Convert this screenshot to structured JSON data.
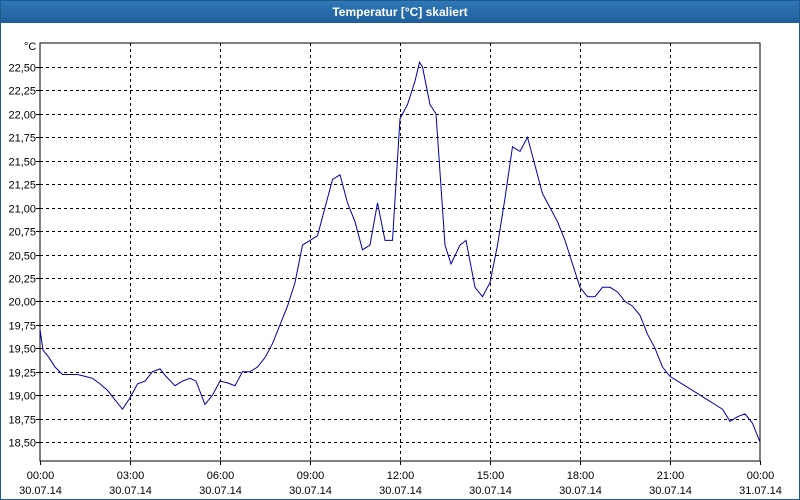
{
  "window": {
    "title": "Temperatur [°C] skaliert"
  },
  "colors": {
    "line": "#0000aa",
    "grid": "#000000",
    "titlebar": "#1f5f99"
  },
  "chart_data": {
    "type": "line",
    "title": "Temperatur [°C] skaliert",
    "yunit": "°C",
    "ylim": [
      18.4,
      22.75
    ],
    "xlim": [
      0,
      24
    ],
    "grid": true,
    "y_ticks": [
      {
        "value": 18.5,
        "label": "18,50"
      },
      {
        "value": 18.75,
        "label": "18,75"
      },
      {
        "value": 19.0,
        "label": "19,00"
      },
      {
        "value": 19.25,
        "label": "19,25"
      },
      {
        "value": 19.5,
        "label": "19,50"
      },
      {
        "value": 19.75,
        "label": "19,75"
      },
      {
        "value": 20.0,
        "label": "20,00"
      },
      {
        "value": 20.25,
        "label": "20,25"
      },
      {
        "value": 20.5,
        "label": "20,50"
      },
      {
        "value": 20.75,
        "label": "20,75"
      },
      {
        "value": 21.0,
        "label": "21,00"
      },
      {
        "value": 21.25,
        "label": "21,25"
      },
      {
        "value": 21.5,
        "label": "21,50"
      },
      {
        "value": 21.75,
        "label": "21,75"
      },
      {
        "value": 22.0,
        "label": "22,00"
      },
      {
        "value": 22.25,
        "label": "22,25"
      },
      {
        "value": 22.5,
        "label": "22,50"
      }
    ],
    "x_ticks": [
      {
        "value": 0,
        "time": "00:00",
        "date": "30.07.14"
      },
      {
        "value": 3,
        "time": "03:00",
        "date": "30.07.14"
      },
      {
        "value": 6,
        "time": "06:00",
        "date": "30.07.14"
      },
      {
        "value": 9,
        "time": "09:00",
        "date": "30.07.14"
      },
      {
        "value": 12,
        "time": "12:00",
        "date": "30.07.14"
      },
      {
        "value": 15,
        "time": "15:00",
        "date": "30.07.14"
      },
      {
        "value": 18,
        "time": "18:00",
        "date": "30.07.14"
      },
      {
        "value": 21,
        "time": "21:00",
        "date": "30.07.14"
      },
      {
        "value": 24,
        "time": "00:00",
        "date": "31.07.14"
      }
    ],
    "series": [
      {
        "x": [
          0,
          0.1,
          0.3,
          0.5,
          0.75,
          1.0,
          1.25,
          1.5,
          1.75,
          2.0,
          2.25,
          2.5,
          2.75,
          3.0,
          3.25,
          3.5,
          3.75,
          4.0,
          4.2,
          4.5,
          4.75,
          5.0,
          5.2,
          5.5,
          5.75,
          6.0,
          6.25,
          6.5,
          6.75,
          7.0,
          7.25,
          7.5,
          7.75,
          8.0,
          8.25,
          8.5,
          8.75,
          9.0,
          9.25,
          9.5,
          9.75,
          10.0,
          10.25,
          10.5,
          10.75,
          11.0,
          11.25,
          11.5,
          11.75,
          12.0,
          12.25,
          12.5,
          12.65,
          12.75,
          13.0,
          13.2,
          13.5,
          13.7,
          14.0,
          14.2,
          14.5,
          14.75,
          15.0,
          15.25,
          15.5,
          15.75,
          16.0,
          16.25,
          16.5,
          16.75,
          17.0,
          17.25,
          17.5,
          17.75,
          18.0,
          18.25,
          18.5,
          18.75,
          19.0,
          19.25,
          19.5,
          19.75,
          20.0,
          20.25,
          20.5,
          20.75,
          21.0,
          21.25,
          21.5,
          21.75,
          22.0,
          22.25,
          22.5,
          22.75,
          23.0,
          23.25,
          23.5,
          23.75,
          24.0
        ],
        "values": [
          19.7,
          19.48,
          19.4,
          19.3,
          19.22,
          19.22,
          19.22,
          19.2,
          19.18,
          19.12,
          19.05,
          18.95,
          18.85,
          18.97,
          19.12,
          19.15,
          19.25,
          19.28,
          19.2,
          19.1,
          19.15,
          19.18,
          19.15,
          18.9,
          19.0,
          19.15,
          19.13,
          19.1,
          19.25,
          19.25,
          19.3,
          19.4,
          19.55,
          19.75,
          19.95,
          20.2,
          20.6,
          20.65,
          20.7,
          21.0,
          21.3,
          21.35,
          21.05,
          20.85,
          20.55,
          20.6,
          21.05,
          20.65,
          20.65,
          21.95,
          22.1,
          22.35,
          22.55,
          22.5,
          22.1,
          22.0,
          20.6,
          20.4,
          20.6,
          20.65,
          20.15,
          20.05,
          20.2,
          20.6,
          21.1,
          21.65,
          21.6,
          21.75,
          21.45,
          21.15,
          21.0,
          20.85,
          20.65,
          20.4,
          20.15,
          20.05,
          20.05,
          20.15,
          20.15,
          20.1,
          20.0,
          19.95,
          19.85,
          19.65,
          19.5,
          19.3,
          19.2,
          19.15,
          19.1,
          19.05,
          19.0,
          18.95,
          18.9,
          18.85,
          18.72,
          18.77,
          18.8,
          18.7,
          18.5
        ]
      }
    ]
  }
}
